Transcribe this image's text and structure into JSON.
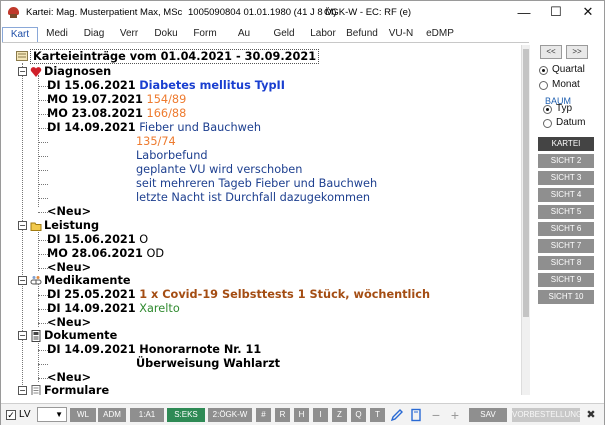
{
  "window": {
    "title_patient": "Kartei: Mag. Musterpatient Max, MSc",
    "title_id": "1005090804 01.01.1980 (41 J 8 M)",
    "title_insurance": "ÖGK-W - EC: RF (e)",
    "minimize": "—",
    "maximize": "☐",
    "close": "✕"
  },
  "tabs": [
    "Kart",
    "Medi",
    "Diag",
    "Verr",
    "Doku",
    "Form",
    "Au",
    "Geld",
    "Labor",
    "Befund",
    "VU-N",
    "eDMP"
  ],
  "active_tab": "Kart",
  "tree": {
    "root": "Karteieinträge vom 01.04.2021 - 30.09.2021",
    "diagnosen": {
      "title": "Diagnosen",
      "entries": [
        {
          "day": "DI",
          "date": "15.06.2021",
          "text": "Diabetes mellitus TypII"
        },
        {
          "day": "MO",
          "date": "19.07.2021",
          "text": "154/89"
        },
        {
          "day": "MO",
          "date": "23.08.2021",
          "text": "166/88"
        },
        {
          "day": "DI",
          "date": "14.09.2021",
          "text": "Fieber und Bauchweh"
        }
      ],
      "sub": [
        "135/74",
        "Laborbefund",
        "geplante VU wird verschoben",
        "seit mehreren Tageb Fieber und Bauchweh",
        "letzte Nacht ist Durchfall dazugekommen"
      ],
      "new": "<Neu>"
    },
    "leistung": {
      "title": "Leistung",
      "entries": [
        {
          "day": "DI",
          "date": "15.06.2021",
          "text": "O"
        },
        {
          "day": "MO",
          "date": "28.06.2021",
          "text": "OD"
        }
      ],
      "new": "<Neu>"
    },
    "medikamente": {
      "title": "Medikamente",
      "entries": [
        {
          "day": "DI",
          "date": "25.05.2021",
          "text": "1 x Covid-19 Selbsttests 1 Stück, wöchentlich"
        },
        {
          "day": "DI",
          "date": "14.09.2021",
          "text": "Xarelto"
        }
      ],
      "new": "<Neu>"
    },
    "dokumente": {
      "title": "Dokumente",
      "entries": [
        {
          "day": "DI",
          "date": "14.09.2021",
          "text": "Honorarnote Nr. 11"
        }
      ],
      "sub": [
        "Überweisung Wahlarzt"
      ],
      "new": "<Neu>"
    },
    "formulare": {
      "title": "Formulare"
    }
  },
  "right_panel": {
    "prev": "<<",
    "next": ">>",
    "quartal": "Quartal",
    "monat": "Monat",
    "baum": "BAUM",
    "typ": "Typ",
    "datum": "Datum",
    "views": [
      "KARTEI",
      "SICHT 2",
      "SICHT 3",
      "SICHT 4",
      "SICHT 5",
      "SICHT 6",
      "SICHT 7",
      "SICHT 8",
      "SICHT 9",
      "SICHT 10"
    ]
  },
  "bottom": {
    "lv": "LV",
    "buttons": {
      "wl": "WL",
      "adm": "ADM",
      "a1": "1:A1",
      "seks": "S:EKS",
      "ogkw": "2:ÖGK-W",
      "hash": "#",
      "r": "R",
      "h": "H",
      "i": "I",
      "z": "Z",
      "q": "Q",
      "t": "T",
      "sav": "SAV",
      "vorbestellung": "VORBESTELLUNG"
    },
    "minus": "−",
    "plus": "+",
    "close": "✖"
  },
  "colors": {
    "diagnose_blue": "#1a3fd0",
    "value_orange": "#ee7b2f",
    "text_blue": "#1d3f8f",
    "med_brown": "#a44d13",
    "med_green": "#2f8a2f",
    "active_green": "#2e8a55"
  }
}
